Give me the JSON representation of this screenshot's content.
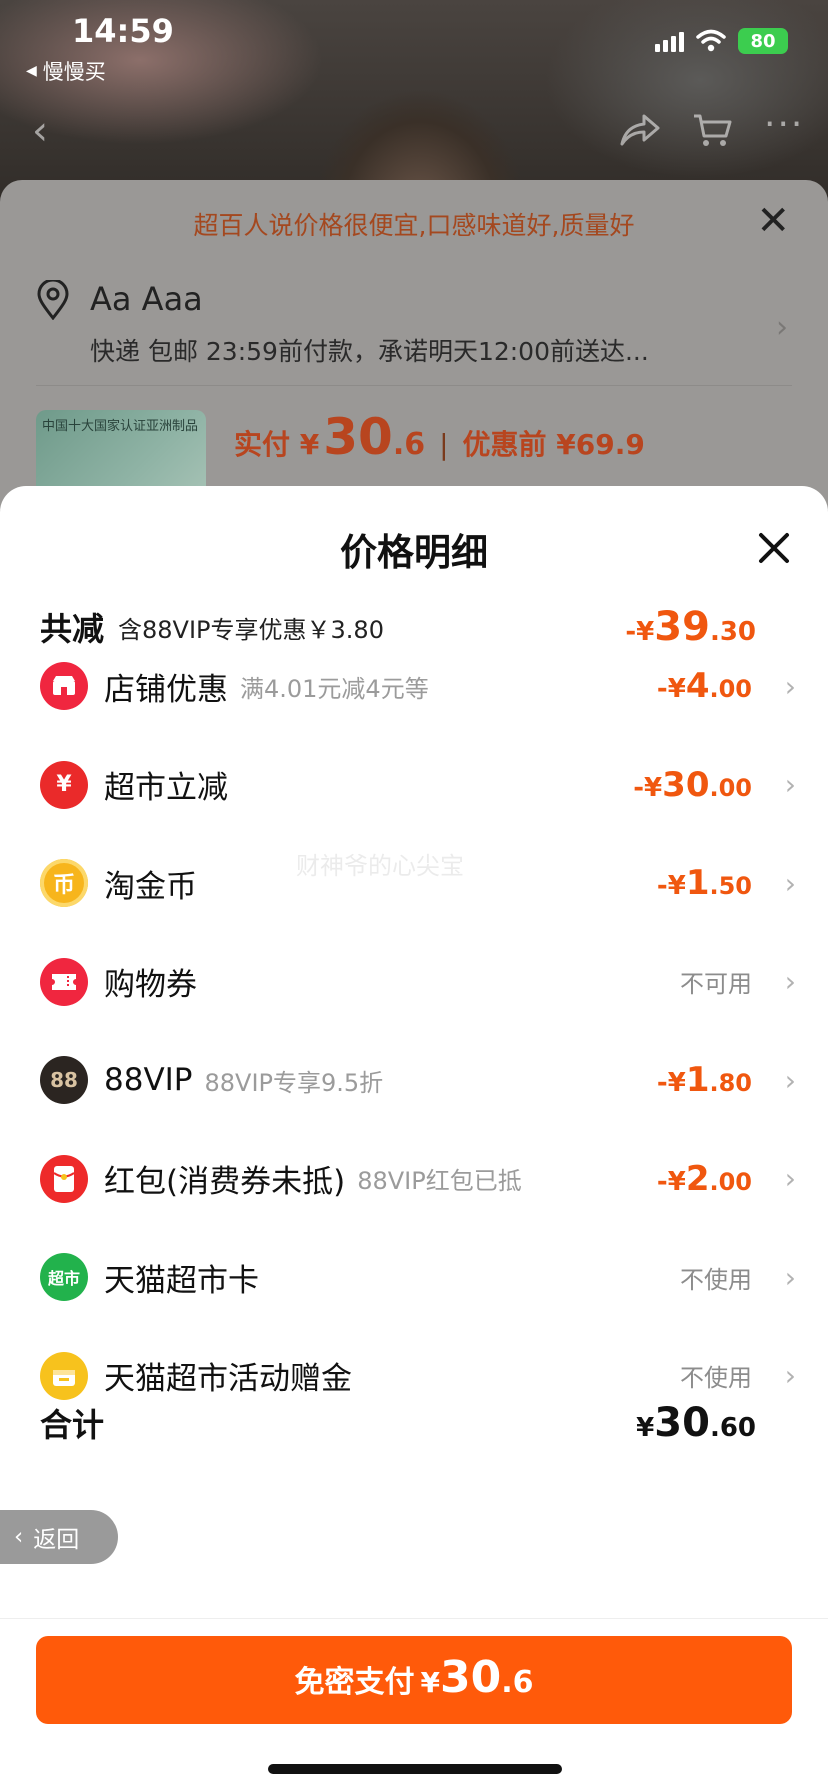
{
  "status_bar": {
    "time": "14:59",
    "back_app": "慢慢买",
    "battery": "80"
  },
  "order_sheet": {
    "promo": "超百人说价格很便宜,口感味道好,质量好",
    "address_name": "Aa Aaa",
    "address_detail": "快递 包邮 23:59前付款，承诺明天12:00前送达...",
    "thumb_text": "中国十大国家认证亚洲制品",
    "paid_label": "实付 ¥",
    "paid_int": "30",
    "paid_dec": ".6",
    "orig_label": "优惠前 ¥69.9"
  },
  "detail": {
    "title": "价格明细",
    "watermark": "财神爷的心尖宝",
    "total": {
      "label": "共减",
      "sub": "含88VIP专享优惠￥3.80",
      "sym": "-¥",
      "int": "39",
      "dec": ".30"
    },
    "rows": [
      {
        "label": "店铺优惠",
        "sub": "满4.01元减4元等",
        "sym": "-¥",
        "int": "4",
        "dec": ".00",
        "text": "",
        "icon": "store-icon",
        "icon_glyph": "",
        "color": "#f0263f"
      },
      {
        "label": "超市立减",
        "sub": "",
        "sym": "-¥",
        "int": "30",
        "dec": ".00",
        "text": "",
        "icon": "yuan-coin-icon",
        "icon_glyph": "¥",
        "color": "#ea2a2a"
      },
      {
        "label": "淘金币",
        "sub": "",
        "sym": "-¥",
        "int": "1",
        "dec": ".50",
        "text": "",
        "icon": "gold-coin-icon",
        "icon_glyph": "币",
        "color": "#f7b51c"
      },
      {
        "label": "购物券",
        "sub": "",
        "sym": "",
        "int": "",
        "dec": "",
        "text": "不可用",
        "icon": "ticket-icon",
        "icon_glyph": "",
        "color": "#f0263f"
      },
      {
        "label": "88VIP",
        "sub": "88VIP专享9.5折",
        "sym": "-¥",
        "int": "1",
        "dec": ".80",
        "text": "",
        "icon": "vip88-icon",
        "icon_glyph": "88",
        "color": "#2b2521"
      },
      {
        "label": "红包(消费券未抵)",
        "sub": "88VIP红包已抵",
        "sym": "-¥",
        "int": "2",
        "dec": ".00",
        "text": "",
        "icon": "red-packet-icon",
        "icon_glyph": "",
        "color": "#ee2a2a"
      },
      {
        "label": "天猫超市卡",
        "sub": "",
        "sym": "",
        "int": "",
        "dec": "",
        "text": "不使用",
        "icon": "tmall-market-card-icon",
        "icon_glyph": "超市",
        "color": "#22b24c"
      },
      {
        "label": "天猫超市活动赠金",
        "sub": "",
        "sym": "",
        "int": "",
        "dec": "",
        "text": "不使用",
        "icon": "gift-money-icon",
        "icon_glyph": "",
        "color": "#f7c21d"
      }
    ],
    "sum": {
      "label": "合计",
      "sym": "¥",
      "int": "30",
      "dec": ".60"
    }
  },
  "return_label": "返回",
  "pay_button": {
    "label": "免密支付",
    "sym": "¥",
    "int": "30",
    "dec": ".6"
  },
  "colors": {
    "accent": "#ff5a0a",
    "discount": "#f0570f"
  }
}
